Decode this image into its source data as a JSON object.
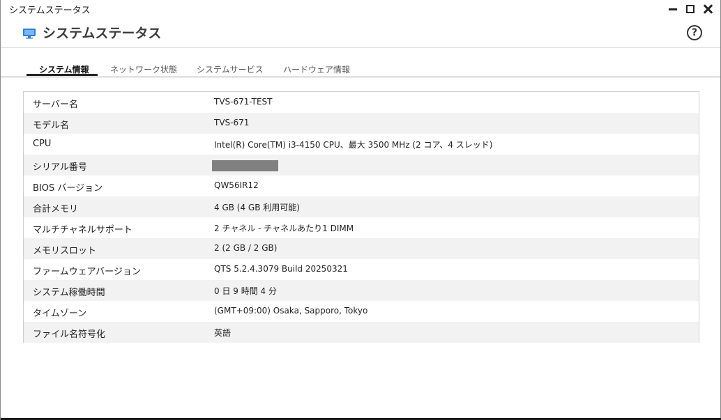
{
  "window": {
    "title": "システムステータス"
  },
  "header": {
    "title": "システムステータス",
    "help_label": "?"
  },
  "tabs": [
    {
      "label": "システム情報",
      "active": true
    },
    {
      "label": "ネットワーク状態",
      "active": false
    },
    {
      "label": "システムサービス",
      "active": false
    },
    {
      "label": "ハードウェア情報",
      "active": false
    }
  ],
  "rows": [
    {
      "label": "サーバー名",
      "value": "TVS-671-TEST"
    },
    {
      "label": "モデル名",
      "value": "TVS-671"
    },
    {
      "label": "CPU",
      "value": "Intel(R) Core(TM) i3-4150 CPU、最大 3500 MHz (2 コア、4 スレッド)"
    },
    {
      "label": "シリアル番号",
      "value": ""
    },
    {
      "label": "BIOS バージョン",
      "value": "QW56IR12"
    },
    {
      "label": "合計メモリ",
      "value": "4 GB (4 GB 利用可能)"
    },
    {
      "label": "マルチチャネルサポート",
      "value": "2 チャネル - チャネルあたり1 DIMM"
    },
    {
      "label": "メモリスロット",
      "value": "2 (2 GB / 2 GB)"
    },
    {
      "label": "ファームウェアバージョン",
      "value": "QTS 5.2.4.3079 Build 20250321"
    },
    {
      "label": "システム稼働時間",
      "value": "0 日 9 時間 4 分"
    },
    {
      "label": "タイムゾーン",
      "value": "(GMT+09:00) Osaka, Sapporo, Tokyo"
    },
    {
      "label": "ファイル名符号化",
      "value": "英語"
    }
  ],
  "colors": {
    "accent_icon": "#2f7fd6",
    "alt_row": "#f2f2f2",
    "redaction": "#808080"
  }
}
